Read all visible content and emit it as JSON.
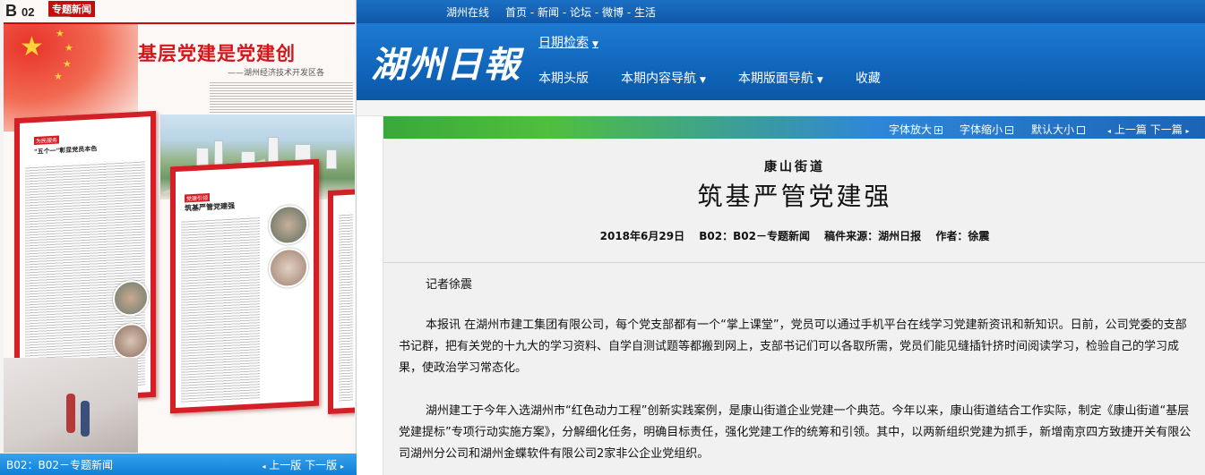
{
  "left_page": {
    "page_letter": "B",
    "page_number": "02",
    "section_tag": "专题新闻",
    "headline": "基层党建是党建创",
    "subheadline": "——湖州经济技术开发区各",
    "panel1": {
      "tag": "为民服务",
      "title": "\"五个一\"彰显党员本色"
    },
    "panel2": {
      "tag": "党建引领",
      "title": "筑基严管党建强"
    },
    "footer_label": "B02：B02－专题新闻",
    "prev_label": "上一版",
    "next_label": "下一版"
  },
  "topbar": {
    "site": "湖州在线",
    "links": [
      "首页",
      "新闻",
      "论坛",
      "微博",
      "生活"
    ]
  },
  "header": {
    "logo": "湖州日報",
    "date_search": "日期检索",
    "nav": [
      "本期头版",
      "本期内容导航",
      "本期版面导航",
      "收藏"
    ]
  },
  "tools": {
    "font_bigger": "字体放大",
    "font_smaller": "字体缩小",
    "font_default": "默认大小",
    "prev_article": "上一篇",
    "next_article": "下一篇"
  },
  "article": {
    "kicker": "康山街道",
    "title": "筑基严管党建强",
    "date": "2018年6月29日",
    "page": "B02：B02－专题新闻",
    "source": "稿件来源：湖州日报",
    "author": "作者：徐震",
    "byline": "记者徐震",
    "paragraphs": [
      "本报讯 在湖州市建工集团有限公司，每个党支部都有一个“掌上课堂”，党员可以通过手机平台在线学习党建新资讯和新知识。日前，公司党委的支部书记群，把有关党的十九大的学习资料、自学自测试题等都搬到网上，支部书记们可以各取所需，党员们能见缝插针挤时间阅读学习，检验自己的学习成果，使政治学习常态化。",
      "湖州建工于今年入选湖州市“红色动力工程”创新实践案例，是康山街道企业党建一个典范。今年以来，康山街道结合工作实际，制定《康山街道“基层党建提标”专项行动实施方案》，分解细化任务，明确目标责任，强化党建工作的统筹和引领。其中，以两新组织党建为抓手，新增南京四方致捷开关有限公司湖州分公司和湖州金蝶软件有限公司2家非公企业党组织。"
    ]
  }
}
